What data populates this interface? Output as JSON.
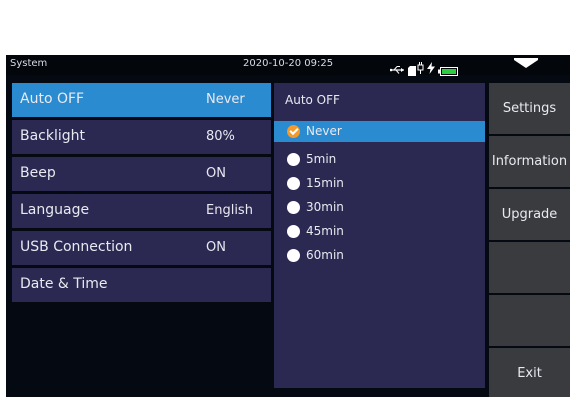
{
  "status": {
    "title": "System",
    "time": "2020-10-20 09:25",
    "icons": [
      "usb-icon",
      "sd-card-icon",
      "charging-icon",
      "battery-icon",
      "dropdown-arrow-icon"
    ],
    "battery_color": "#2ecc40"
  },
  "menu": {
    "items": [
      {
        "label": "Auto OFF",
        "value": "Never",
        "selected": true
      },
      {
        "label": "Backlight",
        "value": "80%"
      },
      {
        "label": "Beep",
        "value": "ON"
      },
      {
        "label": "Language",
        "value": "English"
      },
      {
        "label": "USB Connection",
        "value": "ON"
      },
      {
        "label": "Date & Time",
        "value": ""
      }
    ]
  },
  "options": {
    "title": "Auto OFF",
    "items": [
      {
        "label": "Never",
        "selected": true
      },
      {
        "label": "5min"
      },
      {
        "label": "15min"
      },
      {
        "label": "30min"
      },
      {
        "label": "45min"
      },
      {
        "label": "60min"
      }
    ]
  },
  "sidebar": {
    "buttons": [
      "Settings",
      "Information",
      "Upgrade",
      "",
      "",
      "Exit"
    ]
  },
  "colors": {
    "accent": "#2b8bd0",
    "panel": "#2b2952",
    "checked": "#f29a2e",
    "sidebar_button": "#3a3b3f"
  }
}
